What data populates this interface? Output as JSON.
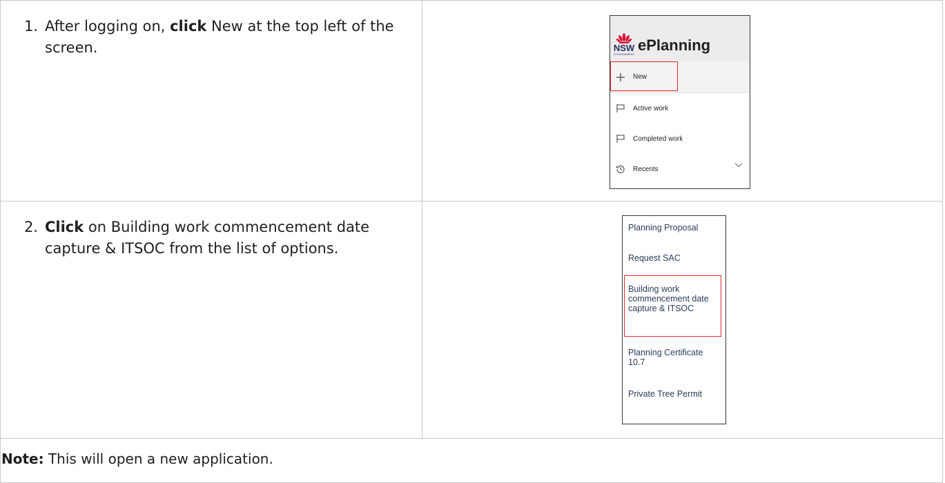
{
  "steps": [
    {
      "number": "1.",
      "keyword": "click",
      "text_before": "After logging on, ",
      "text_after": " New at the top left of the screen."
    },
    {
      "number": "2.",
      "keyword": "Click",
      "text_before": "",
      "text_after": " on Building work commencement date capture & ITSOC from the list of options."
    }
  ],
  "menu_screenshot": {
    "logo_text": "NSW",
    "logo_subtext": "GOVERNMENT",
    "brand": "ePlanning",
    "items": [
      {
        "label": "New",
        "icon": "plus-icon"
      },
      {
        "label": "Active work",
        "icon": "flag-icon"
      },
      {
        "label": "Completed work",
        "icon": "flag-icon"
      },
      {
        "label": "Recents",
        "icon": "history-icon"
      }
    ],
    "highlight_color": "#e3262c"
  },
  "options_screenshot": {
    "items": [
      "Planning Proposal",
      "Request SAC",
      "Building work commencement date capture & ITSOC",
      "Planning Certificate 10.7",
      "Private Tree Permit"
    ],
    "highlighted_index": 2,
    "highlight_color": "#e3262c"
  },
  "note": {
    "label": "Note:",
    "text": "This will open a new application."
  }
}
